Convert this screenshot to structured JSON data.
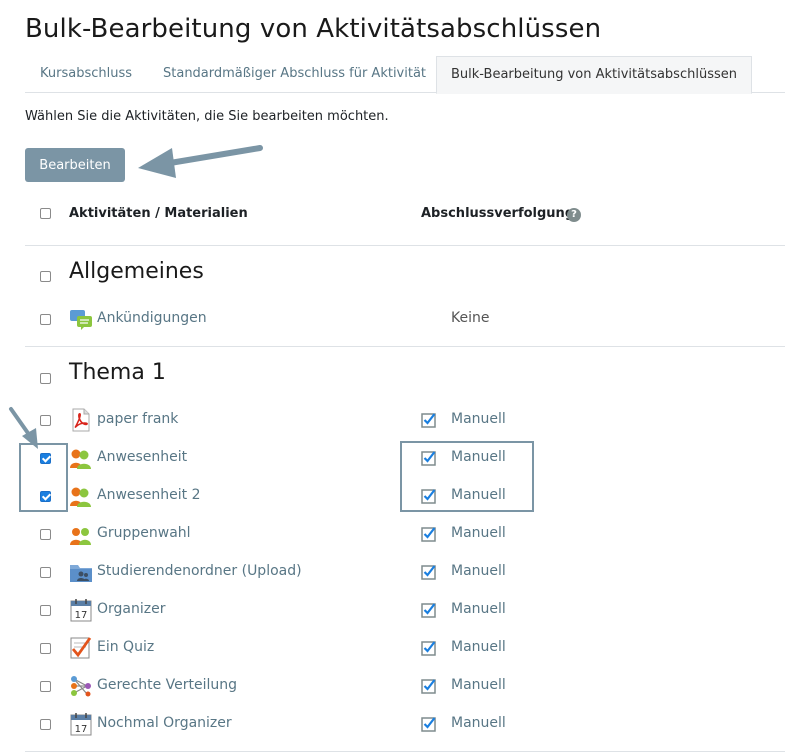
{
  "page": {
    "title": "Bulk-Bearbeitung von Aktivitätsabschlüssen",
    "instruction": "Wählen Sie die Aktivitäten, die Sie bearbeiten möchten."
  },
  "tabs": [
    {
      "label": "Kursabschluss",
      "active": false
    },
    {
      "label": "Standardmäßiger Abschluss für Aktivität",
      "active": false
    },
    {
      "label": "Bulk-Bearbeitung von Aktivitätsabschlüssen",
      "active": true
    }
  ],
  "toolbar": {
    "edit_label": "Bearbeiten"
  },
  "table": {
    "col_activities": "Aktivitäten / Materialien",
    "col_completion": "Abschlussverfolgung",
    "help_icon": "question-circle-icon"
  },
  "sections": [
    {
      "title": "Allgemeines",
      "items": [
        {
          "name": "Ankündigungen",
          "icon": "forum-icon",
          "completion": "Keine",
          "tracked": false,
          "checked": false
        }
      ]
    },
    {
      "title": "Thema 1",
      "items": [
        {
          "name": "paper frank",
          "icon": "pdf-icon",
          "completion": "Manuell",
          "tracked": true,
          "checked": false
        },
        {
          "name": "Anwesenheit",
          "icon": "attendance-icon",
          "completion": "Manuell",
          "tracked": true,
          "checked": true
        },
        {
          "name": "Anwesenheit 2",
          "icon": "attendance-icon",
          "completion": "Manuell",
          "tracked": true,
          "checked": true
        },
        {
          "name": "Gruppenwahl",
          "icon": "group-choice-icon",
          "completion": "Manuell",
          "tracked": true,
          "checked": false
        },
        {
          "name": "Studierendenordner (Upload)",
          "icon": "folder-users-icon",
          "completion": "Manuell",
          "tracked": true,
          "checked": false
        },
        {
          "name": "Organizer",
          "icon": "calendar-icon",
          "completion": "Manuell",
          "tracked": true,
          "checked": false
        },
        {
          "name": "Ein Quiz",
          "icon": "quiz-icon",
          "completion": "Manuell",
          "tracked": true,
          "checked": false
        },
        {
          "name": "Gerechte Verteilung",
          "icon": "ratings-allocate-icon",
          "completion": "Manuell",
          "tracked": true,
          "checked": false
        },
        {
          "name": "Nochmal Organizer",
          "icon": "calendar-icon",
          "completion": "Manuell",
          "tracked": true,
          "checked": false
        }
      ]
    }
  ],
  "colors": {
    "accent": "#7b95a5",
    "link": "#587685",
    "check": "#1a7fe0"
  }
}
